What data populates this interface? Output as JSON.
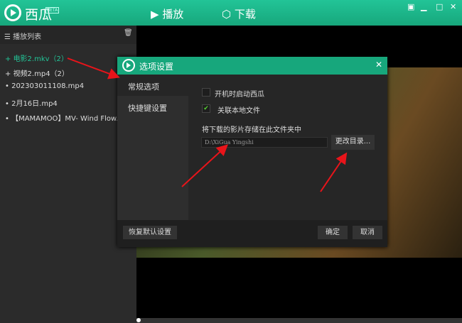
{
  "header": {
    "brand": "西瓜",
    "beta": "BETA",
    "nav": [
      {
        "label": "播放",
        "icon": "play-icon"
      },
      {
        "label": "下载",
        "icon": "download-box-icon"
      }
    ],
    "window_buttons": [
      "mini-mode",
      "minimize",
      "maximize",
      "close"
    ]
  },
  "sidebar": {
    "title": "播放列表",
    "items": [
      {
        "label": "电影2.mkv（2）",
        "type": "group",
        "active": true
      },
      {
        "label": "视频2.mp4（2）",
        "type": "group"
      },
      {
        "label": "202303011108.mp4",
        "type": "file"
      },
      {
        "label": "2月16日.mp4",
        "type": "file"
      },
      {
        "label": "【MAMAMOO】MV- Wind Flow...",
        "type": "file"
      }
    ]
  },
  "dialog": {
    "title": "选项设置",
    "close": "✕",
    "nav": [
      "常规选项",
      "快捷键设置"
    ],
    "options": [
      {
        "label": "开机时启动西瓜",
        "checked": false
      },
      {
        "label": "关联本地文件",
        "checked": true
      }
    ],
    "folder_label": "将下载的影片存储在此文件夹中",
    "folder_value": "D:\\XiGua Yingshi",
    "change_dir": "更改目录...",
    "reset": "恢复默认设置",
    "ok": "确定",
    "cancel": "取消"
  },
  "colors": {
    "accent": "#17a77c",
    "arrow": "#e8141a"
  }
}
